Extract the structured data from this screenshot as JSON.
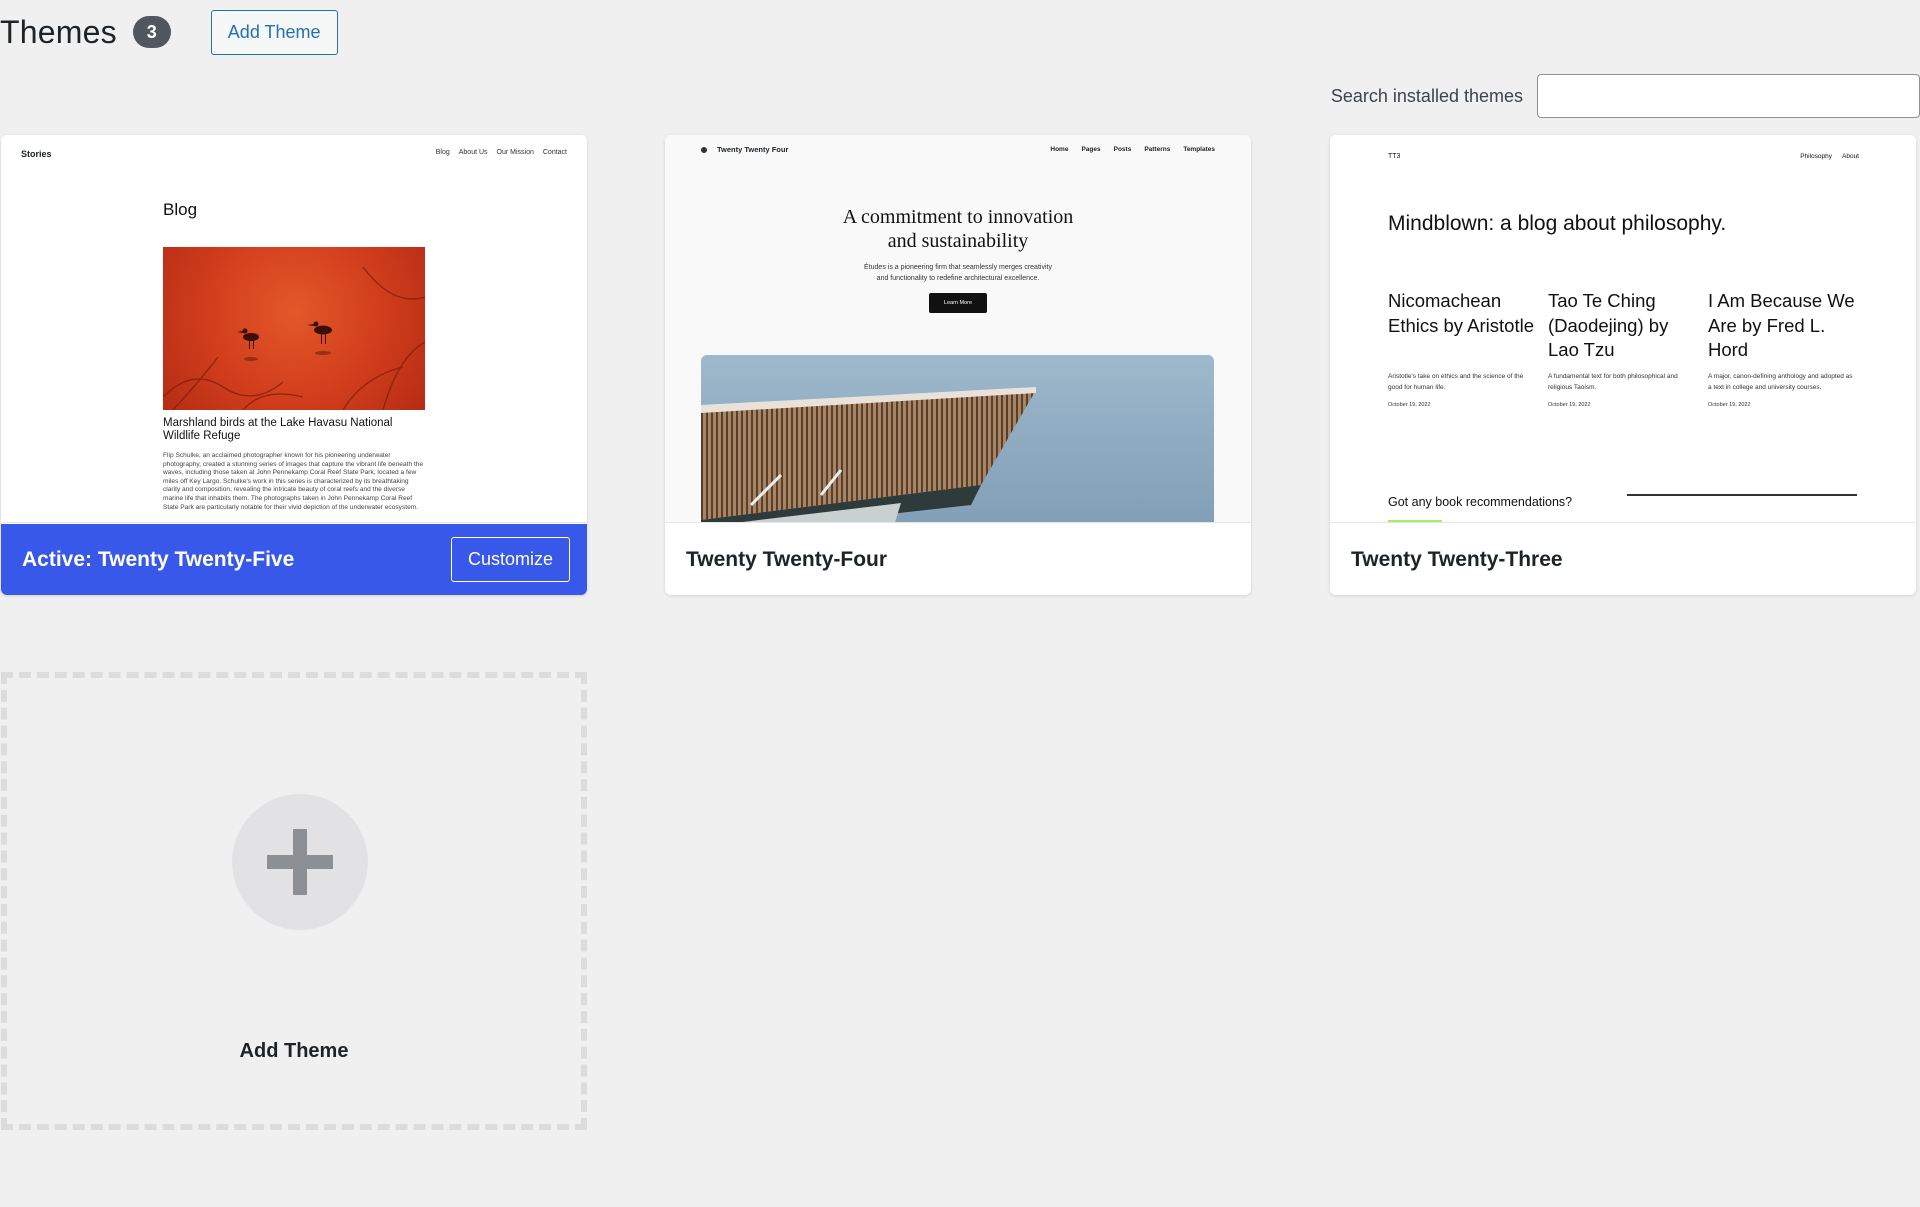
{
  "header": {
    "title": "Themes",
    "count": "3",
    "add_button": "Add Theme"
  },
  "search": {
    "label": "Search installed themes",
    "value": "",
    "placeholder": ""
  },
  "themes": [
    {
      "name": "Twenty Twenty-Five",
      "active_prefix": "Active:",
      "customize_label": "Customize",
      "preview": {
        "site_title": "Stories",
        "nav": [
          "Blog",
          "About Us",
          "Our Mission",
          "Contact"
        ],
        "heading": "Blog",
        "post_title": "Marshland birds at the Lake Havasu National Wildlife Refuge",
        "post_body": "Flip Schulke, an acclaimed photographer known for his pioneering underwater photography, created a stunning series of images that capture the vibrant life beneath the waves, including those taken at John Pennekamp Coral Reef State Park, located a few miles off Key Largo. Schulke's work in this series is characterized by its breathtaking clarity and composition, revealing the intricate beauty of coral reefs and the diverse marine life that inhabits them. The photographs taken in John Pennekamp Coral Reef State Park are particularly notable for their vivid depiction of the underwater ecosystem."
      }
    },
    {
      "name": "Twenty Twenty-Four",
      "preview": {
        "site_title": "Twenty Twenty Four",
        "nav": [
          "Home",
          "Pages",
          "Posts",
          "Patterns",
          "Templates"
        ],
        "headline_1": "A commitment to innovation",
        "headline_2": "and sustainability",
        "sub_1": "Études is a pioneering firm that seamlessly merges creativity",
        "sub_2": "and functionality to redefine architectural excellence.",
        "button": "Learn More"
      }
    },
    {
      "name": "Twenty Twenty-Three",
      "preview": {
        "site_title": "TT3",
        "nav": [
          "Philosophy",
          "About"
        ],
        "headline": "Mindblown: a blog about philosophy.",
        "posts": [
          {
            "title": "Nicomachean Ethics by Aristotle",
            "excerpt": "Aristotle's take on ethics and the science of the good for human life.",
            "date": "October 19, 2022"
          },
          {
            "title": "Tao Te Ching (Daodejing) by Lao Tzu",
            "excerpt": "A fundamental text for both philosophical and religious Taoism.",
            "date": "October 19, 2022"
          },
          {
            "title": "I Am Because We Are by Fred L. Hord",
            "excerpt": "A major, canon-defining anthology and adopted as a text in college and university courses.",
            "date": "October 19, 2022"
          }
        ],
        "question": "Got any book recommendations?"
      }
    }
  ],
  "add_new": {
    "label": "Add Theme"
  },
  "colors": {
    "active_blue": "#3858e9",
    "link_blue": "#2271b1",
    "background": "#f0f0f1",
    "tt3_accent": "#a6ef5a"
  }
}
